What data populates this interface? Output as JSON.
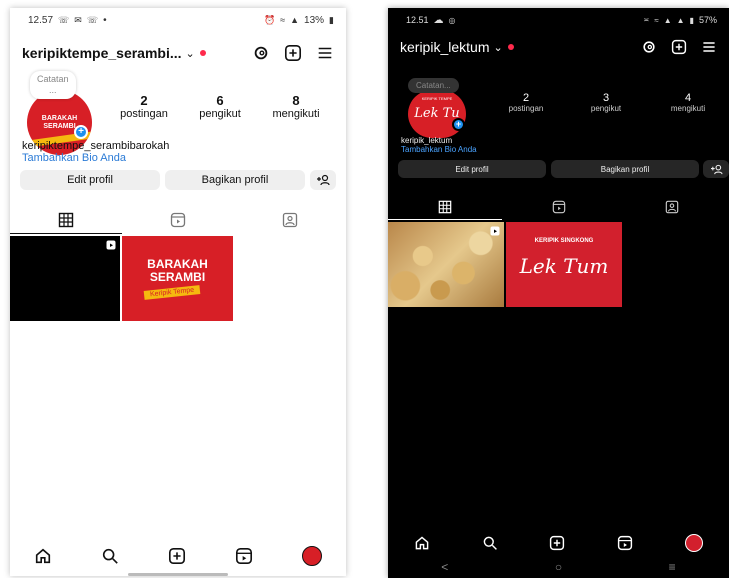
{
  "left_phone": {
    "status": {
      "time": "12.57",
      "left_icons": "whatsapp-icon mail-icon whatsapp-icon",
      "right_text": "13%"
    },
    "username": "keripiktempe_serambi...",
    "note_label": "Catatan",
    "note_sub": "...",
    "avatar_text": "BARAKAH SERAMBI",
    "stats": [
      {
        "value": "2",
        "label": "postingan"
      },
      {
        "value": "6",
        "label": "pengikut"
      },
      {
        "value": "8",
        "label": "mengikuti"
      }
    ],
    "profile_name": "keripiktempe_serambibarokah",
    "bio_link": "Tambahkan Bio Anda",
    "buttons": {
      "edit": "Edit profil",
      "share": "Bagikan profil",
      "add_person": "+♀"
    },
    "posts": [
      {
        "kind": "reel-black"
      },
      {
        "kind": "image",
        "line1": "BARAKAH",
        "line2": "SERAMBI",
        "tag": "Keripik Tempe"
      }
    ]
  },
  "right_phone": {
    "status": {
      "time": "12.51",
      "right_text": "57%"
    },
    "username": "keripik_lektum",
    "note_label": "Catatan...",
    "avatar_text": "Lek Tu",
    "avatar_top": "KERIPIK TEMPE",
    "stats": [
      {
        "value": "2",
        "label": "postingan"
      },
      {
        "value": "3",
        "label": "pengikut"
      },
      {
        "value": "4",
        "label": "mengikuti"
      }
    ],
    "profile_name": "keripik_lektum",
    "bio_link": "Tambahkan Bio Anda",
    "buttons": {
      "edit": "Edit profil",
      "share": "Bagikan profil",
      "add_person": "+♀"
    },
    "posts": [
      {
        "kind": "chips-photo"
      },
      {
        "kind": "image",
        "top": "KERIPIK SINGKONG",
        "brand": "Lek Tum"
      }
    ],
    "sys_nav": {
      "back": "<",
      "home": "○",
      "recents": "≡"
    }
  },
  "colors": {
    "brand_red": "#d71f26",
    "brand_yellow": "#f5b80f",
    "notification_red": "#ff2a4c",
    "link_blue": "#2b7bd6"
  }
}
